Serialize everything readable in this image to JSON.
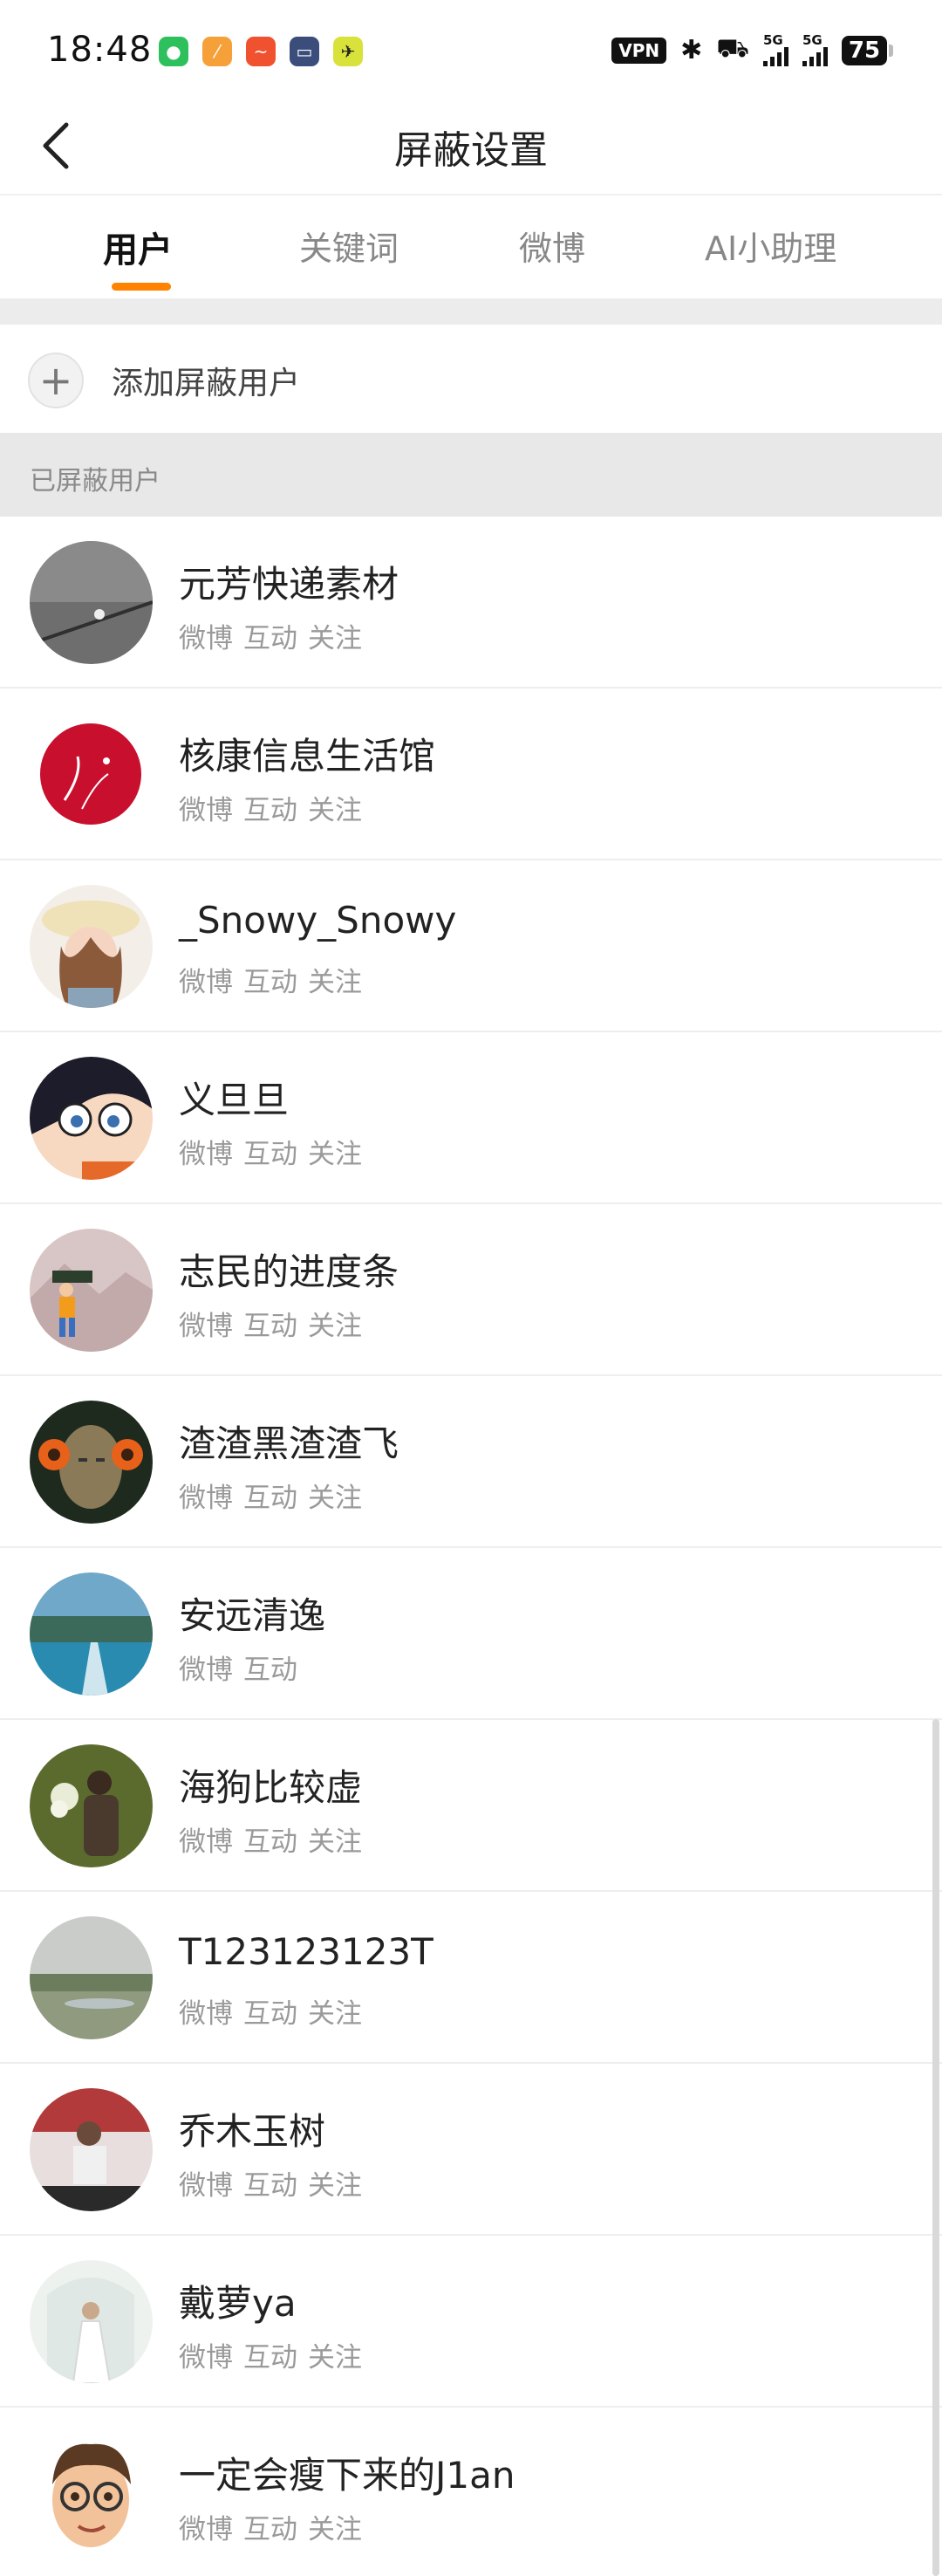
{
  "status_bar": {
    "time": "18:48",
    "vpn": "VPN",
    "bluetooth_glyph": "✱",
    "car_glyph": "⛟",
    "signal_1": "5G",
    "signal_2": "5G",
    "battery": "75",
    "app_icons": [
      "wechat-icon",
      "app-orange-icon",
      "app-red-icon",
      "app-blue-icon",
      "app-yellow-icon"
    ]
  },
  "header": {
    "title": "屏蔽设置"
  },
  "tabs": [
    {
      "label": "用户",
      "active": true
    },
    {
      "label": "关键词",
      "active": false
    },
    {
      "label": "微博",
      "active": false
    },
    {
      "label": "AI小助理",
      "active": false
    }
  ],
  "add_user": {
    "plus": "+",
    "label": "添加屏蔽用户"
  },
  "section": {
    "label": "已屏蔽用户"
  },
  "users": [
    {
      "name": "元芳快递素材",
      "tags": [
        "微博",
        "互动",
        "关注"
      ]
    },
    {
      "name": "核康信息生活馆",
      "tags": [
        "微博",
        "互动",
        "关注"
      ]
    },
    {
      "name": "_Snowy_Snowy",
      "tags": [
        "微博",
        "互动",
        "关注"
      ]
    },
    {
      "name": "义旦旦",
      "tags": [
        "微博",
        "互动",
        "关注"
      ]
    },
    {
      "name": "志民的进度条",
      "tags": [
        "微博",
        "互动",
        "关注"
      ]
    },
    {
      "name": "渣渣黑渣渣飞",
      "tags": [
        "微博",
        "互动",
        "关注"
      ]
    },
    {
      "name": "安远清逸",
      "tags": [
        "微博",
        "互动"
      ]
    },
    {
      "name": "海狗比较虚",
      "tags": [
        "微博",
        "互动",
        "关注"
      ]
    },
    {
      "name": "T123123123T",
      "tags": [
        "微博",
        "互动",
        "关注"
      ]
    },
    {
      "name": "乔木玉树",
      "tags": [
        "微博",
        "互动",
        "关注"
      ]
    },
    {
      "name": "戴萝ya",
      "tags": [
        "微博",
        "互动",
        "关注"
      ]
    },
    {
      "name": "一定会瘦下来的J1an",
      "tags": [
        "微博",
        "互动",
        "关注"
      ]
    }
  ],
  "colors": {
    "accent": "#ff8200",
    "section_bg": "#e8e8e8",
    "tag_text": "#9a9a9a"
  }
}
